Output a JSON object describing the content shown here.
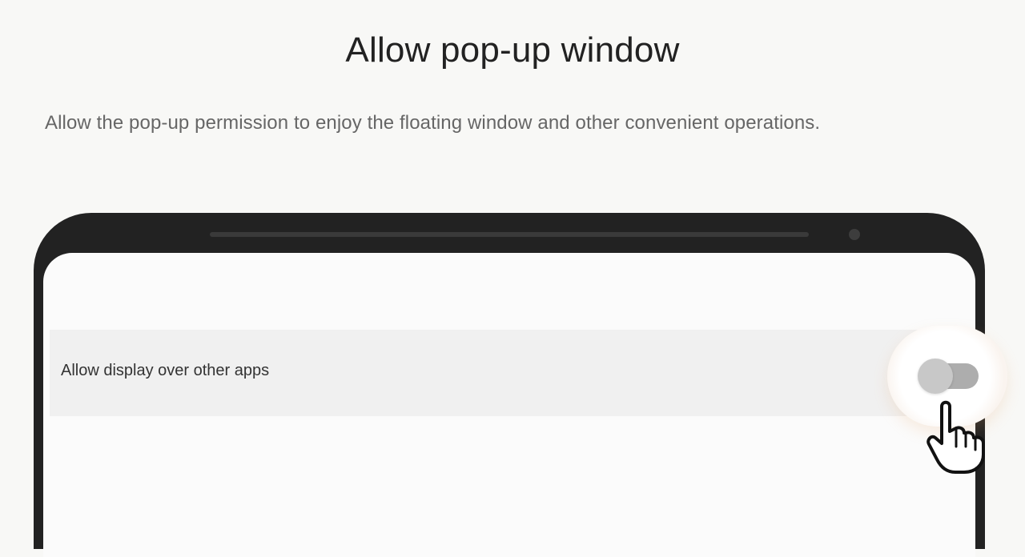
{
  "header": {
    "title": "Allow pop-up window",
    "subtitle": "Allow the pop-up permission to enjoy the floating window and other convenient operations."
  },
  "phone": {
    "setting": {
      "label": "Allow display over other apps",
      "toggle_state": "off"
    },
    "icons": {
      "pointer": "hand-pointer-icon"
    }
  },
  "colors": {
    "background": "#f8f8f6",
    "phone_frame": "#222222",
    "screen": "#fbfbfb",
    "row": "#f0f0f0",
    "toggle_track": "#adadad",
    "toggle_thumb": "#c8c8c8",
    "halo_glow": "#e8a46c"
  }
}
